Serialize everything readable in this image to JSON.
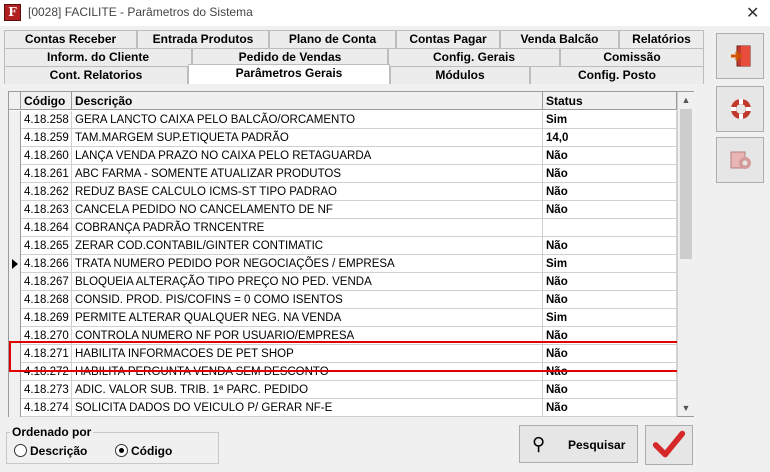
{
  "window": {
    "title": "[0028] FACILITE - Parâmetros do Sistema"
  },
  "tabs": [
    "Contas Receber",
    "Entrada Produtos",
    "Plano de Conta",
    "Contas Pagar",
    "Venda Balcão",
    "Relatórios",
    "Inform. do Cliente",
    "Pedido de Vendas",
    "Config. Gerais",
    "Comissão",
    "Cont. Relatorios",
    "Parâmetros Gerais",
    "Módulos",
    "Config. Posto"
  ],
  "active_tab": "Parâmetros Gerais",
  "grid": {
    "headers": {
      "code": "Código",
      "description": "Descrição",
      "status": "Status"
    },
    "rows": [
      {
        "code": "4.18.258",
        "description": "GERA LANCTO CAIXA PELO BALCÃO/ORCAMENTO",
        "status": "Sim"
      },
      {
        "code": "4.18.259",
        "description": "TAM.MARGEM SUP.ETIQUETA PADRÃO",
        "status": "14,0"
      },
      {
        "code": "4.18.260",
        "description": "LANÇA VENDA PRAZO NO CAIXA PELO RETAGUARDA",
        "status": "Não"
      },
      {
        "code": "4.18.261",
        "description": "ABC FARMA - SOMENTE ATUALIZAR PRODUTOS",
        "status": "Não"
      },
      {
        "code": "4.18.262",
        "description": "REDUZ BASE CALCULO ICMS-ST TIPO PADRAO",
        "status": "Não"
      },
      {
        "code": "4.18.263",
        "description": "CANCELA PEDIDO NO CANCELAMENTO DE NF",
        "status": "Não"
      },
      {
        "code": "4.18.264",
        "description": "COBRANÇA PADRÃO TRNCENTRE",
        "status": ""
      },
      {
        "code": "4.18.265",
        "description": "ZERAR COD.CONTABIL/GINTER CONTIMATIC",
        "status": "Não"
      },
      {
        "code": "4.18.266",
        "description": "TRATA NUMERO PEDIDO POR NEGOCIAÇÕES / EMPRESA",
        "status": "Sim"
      },
      {
        "code": "4.18.267",
        "description": "BLOQUEIA ALTERAÇÃO TIPO PREÇO NO PED. VENDA",
        "status": "Não"
      },
      {
        "code": "4.18.268",
        "description": "CONSID. PROD. PIS/COFINS = 0 COMO ISENTOS",
        "status": "Não"
      },
      {
        "code": "4.18.269",
        "description": "PERMITE ALTERAR QUALQUER NEG. NA VENDA",
        "status": "Sim"
      },
      {
        "code": "4.18.270",
        "description": "CONTROLA NUMERO NF POR USUARIO/EMPRESA",
        "status": "Não"
      },
      {
        "code": "4.18.271",
        "description": "HABILITA INFORMACOES DE PET SHOP",
        "status": "Não"
      },
      {
        "code": "4.18.272",
        "description": "HABILITA PERGUNTA VENDA SEM DESCONTO",
        "status": "Não"
      },
      {
        "code": "4.18.273",
        "description": "ADIC. VALOR SUB. TRIB. 1ª PARC. PEDIDO",
        "status": "Não"
      },
      {
        "code": "4.18.274",
        "description": "SOLICITA DADOS DO VEICULO P/ GERAR NF-E",
        "status": "Não"
      }
    ],
    "selected_code": "4.18.266"
  },
  "order": {
    "legend": "Ordenado por",
    "options": [
      "Descrição",
      "Código"
    ],
    "selected": "Código"
  },
  "buttons": {
    "search_label": "Pesquisar"
  },
  "icons": {
    "exit": "exit-door-icon",
    "help": "lifebuoy-icon",
    "settings": "gear-icon",
    "search": "binoculars-icon",
    "confirm": "checkmark-icon"
  },
  "colors": {
    "highlight": "#e00000",
    "accent": "#c0392b"
  }
}
